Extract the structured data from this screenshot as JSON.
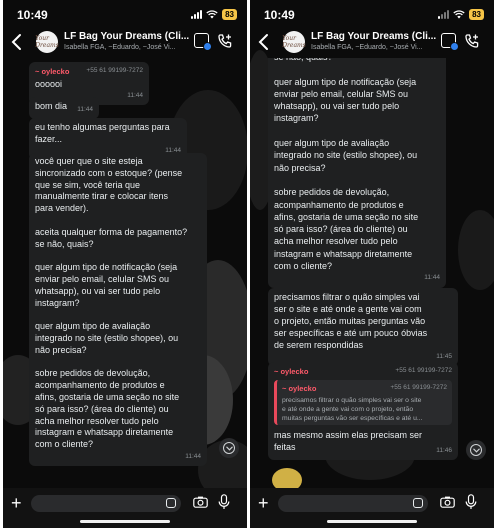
{
  "status": {
    "time": "10:49",
    "battery": "83"
  },
  "header": {
    "title": "LF Bag Your Dreams (Cli...",
    "subtitle": "Isabella FGA, ~Eduardo, ~José Vi...",
    "avatar_text": "Your Dreams"
  },
  "left": {
    "messages": [
      {
        "sender": "~ oylecko",
        "phone": "+55 61 99199-7272",
        "text": "oooooi",
        "time": "11:44"
      },
      {
        "text": "bom dia",
        "time": "11:44"
      },
      {
        "text": "eu tenho algumas perguntas para\nfazer...",
        "time": "11:44"
      },
      {
        "text": "você quer que o site esteja\nsincronizado com o estoque? (pense\nque se sim, você teria que\nmanualmente tirar e colocar itens\npara vender).\n\naceita qualquer forma de pagamento?\nse não, quais?\n\nquer algum tipo de notificação (seja\nenviar pelo email, celular SMS ou\nwhatsapp), ou vai ser tudo pelo\ninstagram?\n\nquer algum tipo de avaliação\nintegrado no site (estilo shopee), ou\nnão precisa?\n\nsobre pedidos de devolução,\nacompanhamento de produtos e\nafins, gostaria de uma seção no site\nsó para isso? (área do cliente) ou\nacha melhor resolver tudo pelo\ninstagram e whatsapp diretamente\ncom o cliente?",
        "time": "11:44"
      }
    ]
  },
  "right": {
    "messages": [
      {
        "text": "se não, quais?\n\nquer algum tipo de notificação (seja\nenviar pelo email, celular SMS ou\nwhatsapp), ou vai ser tudo pelo\ninstagram?\n\nquer algum tipo de avaliação\nintegrado no site (estilo shopee), ou\nnão precisa?\n\nsobre pedidos de devolução,\nacompanhamento de produtos e\nafins, gostaria de uma seção no site\nsó para isso? (área do cliente) ou\nacha melhor resolver tudo pelo\ninstagram e whatsapp diretamente\ncom o cliente?",
        "time": "11:44"
      },
      {
        "text": "precisamos filtrar o quão simples vai\nser o site e até onde a gente vai com\no projeto, então muitas perguntas vão\nser específicas e até um pouco óbvias\nde serem respondidas",
        "time": "11:45"
      },
      {
        "sender": "~ oylecko",
        "phone": "+55 61 99199-7272",
        "quote": {
          "sender": "~ oylecko",
          "phone": "+55 61 99199-7272",
          "text": "precisamos filtrar o quão simples vai ser o site\ne até onde a gente vai com o projeto, então\nmuitas perguntas vão ser específicas e até u..."
        },
        "text": "mas mesmo assim elas precisam ser\nfeitas",
        "time": "11:46"
      }
    ]
  },
  "colors": {
    "bubble": "#1f2021",
    "sender": "#ff5a6a",
    "quote_bar": "#e8495b",
    "background": "#0b0b0b",
    "battery": "#f6c547"
  },
  "icons": [
    "back-chevron-icon",
    "chat-options-icon",
    "add-call-icon",
    "chevron-down-icon",
    "plus-icon",
    "sticker-icon",
    "camera-icon",
    "microphone-icon"
  ]
}
